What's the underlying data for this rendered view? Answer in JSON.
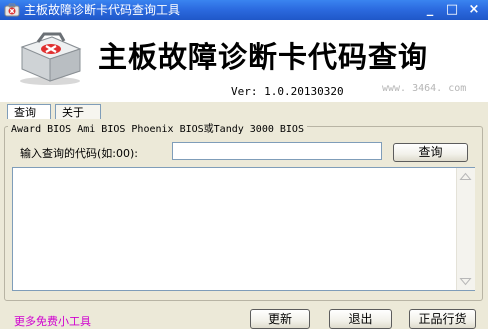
{
  "window": {
    "title": "主板故障诊断卡代码查询工具",
    "minimize_glyph": "_",
    "maximize_glyph": "□",
    "close_glyph": "×"
  },
  "header": {
    "title": "主板故障诊断卡代码查询",
    "version": "Ver: 1.0.20130320",
    "watermark": "www. 3464. com"
  },
  "tabs": [
    {
      "label": "查询",
      "active": true
    },
    {
      "label": "关于",
      "active": false
    }
  ],
  "query_group": {
    "legend": "Award BIOS Ami BIOS Phoenix BIOS或Tandy 3000 BIOS",
    "input_label": "输入查询的代码(如:00):",
    "input_value": "",
    "query_button": "查询"
  },
  "results": {
    "text": ""
  },
  "footer": {
    "more_tools_link": "更多免费小工具",
    "refresh_button": "更新",
    "exit_button": "退出",
    "genuine_button": "正品行货"
  },
  "colors": {
    "titlebar": "#2c6be0",
    "window_bg": "#ece9d8",
    "link": "#d000d0",
    "input_border": "#7f9db9"
  },
  "icons": {
    "app": "first-aid-kit-icon",
    "logo": "first-aid-kit-icon",
    "scroll_up": "triangle-up-icon",
    "scroll_down": "triangle-down-icon"
  }
}
